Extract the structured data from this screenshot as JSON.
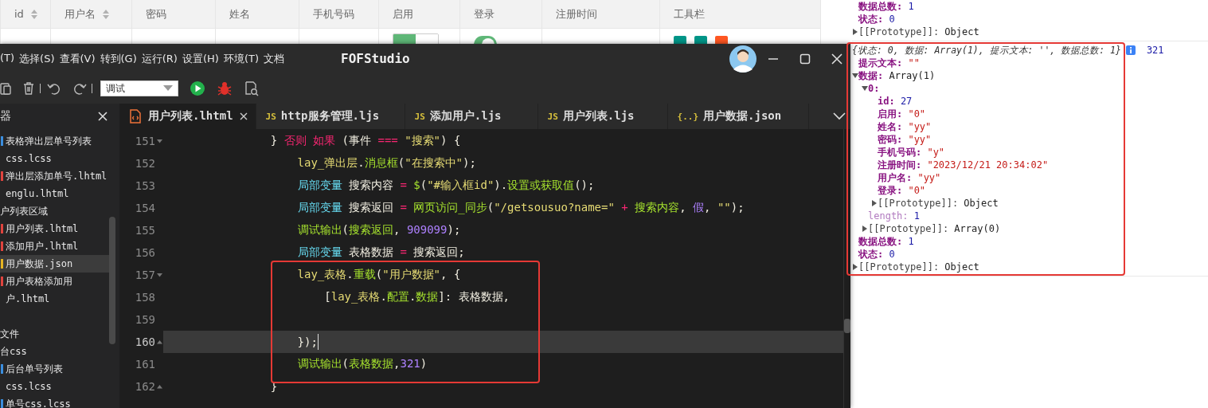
{
  "page_table": {
    "columns": [
      {
        "label": "id",
        "sortable": true
      },
      {
        "label": "用户名",
        "sortable": true
      },
      {
        "label": "密码",
        "sortable": false
      },
      {
        "label": "姓名",
        "sortable": false
      },
      {
        "label": "手机号码",
        "sortable": false
      },
      {
        "label": "启用",
        "sortable": false
      },
      {
        "label": "登录",
        "sortable": false
      },
      {
        "label": "注册时间",
        "sortable": false
      },
      {
        "label": "工具栏",
        "sortable": false
      }
    ],
    "rows": [
      {
        "cells": [
          {
            "kind": "empty"
          },
          {
            "kind": "empty"
          },
          {
            "kind": "empty"
          },
          {
            "kind": "empty"
          },
          {
            "kind": "empty"
          },
          {
            "kind": "switch_button",
            "on": true
          },
          {
            "kind": "toggle",
            "on": true
          },
          {
            "kind": "empty"
          },
          {
            "kind": "actions",
            "buttons": [
              {
                "color": "#009688"
              },
              {
                "color": "#009688"
              },
              {
                "color": "#ff5722"
              }
            ]
          }
        ]
      }
    ]
  },
  "ide": {
    "menu": [
      "(T)",
      "选择(S)",
      "查看(V)",
      "转到(G)",
      "运行(R)",
      "设置(H)",
      "环境(T)",
      "文档"
    ],
    "title": "FOFStudio",
    "mode": "调试",
    "panel_title": "器",
    "tabs": [
      {
        "label": "用户列表.lhtml",
        "kind": "html",
        "selected": true
      },
      {
        "label": "http服务管理.ljs",
        "kind": "js",
        "badge": "JS",
        "selected": false
      },
      {
        "label": "添加用户.ljs",
        "kind": "js",
        "badge": "JS",
        "selected": false
      },
      {
        "label": "用户列表.ljs",
        "kind": "js",
        "badge": "JS",
        "selected": false
      },
      {
        "label": "用户数据.json",
        "kind": "json",
        "badge": "{..}",
        "selected": false
      }
    ],
    "tree": [
      {
        "label": "表格弹出层单号列表",
        "kind": "file",
        "color": "#3b8ede",
        "selected": false
      },
      {
        "label": "css.lcss",
        "kind": "file",
        "selected": false
      },
      {
        "label": "弹出层添加单号.lhtml",
        "kind": "file",
        "color": "#e0443e",
        "selected": false
      },
      {
        "label": "englu.lhtml",
        "kind": "file",
        "selected": false
      },
      {
        "label": "户列表区域",
        "kind": "folder",
        "selected": false,
        "children": [
          {
            "label": "用户列表.lhtml",
            "kind": "file",
            "color": "#e0443e",
            "selected": false
          },
          {
            "label": "添加用户.lhtml",
            "kind": "file",
            "color": "#e0443e",
            "selected": false
          },
          {
            "label": "用户数据.json",
            "kind": "file",
            "color": "#e6b422",
            "selected": true
          },
          {
            "label": "用户表格添加用户.lhtml",
            "kind": "file",
            "color": "#e0443e",
            "selected": false
          }
        ]
      },
      {
        "label": "文件",
        "kind": "folder",
        "selected": false
      },
      {
        "label": "台css",
        "kind": "folder",
        "selected": false,
        "children": [
          {
            "label": "后台单号列表",
            "kind": "file",
            "color": "#3b8ede",
            "selected": false
          },
          {
            "label": "css.lcss",
            "kind": "file",
            "selected": false
          },
          {
            "label": "单号css.lcss",
            "kind": "file",
            "color": "#3b8ede",
            "selected": false
          }
        ]
      }
    ],
    "lines": [
      {
        "number": "151",
        "fold_start": true,
        "tokens": [
          {
            "kind": "plain",
            "text": "                } "
          },
          {
            "kind": "keyword",
            "text": "否则 如果"
          },
          {
            "kind": "plain",
            "text": " (事件 "
          },
          {
            "kind": "keyword",
            "text": "==="
          },
          {
            "kind": "string",
            "text": " \"搜索\""
          },
          {
            "kind": "plain",
            "text": ") {"
          }
        ]
      },
      {
        "number": "152",
        "tokens": [
          {
            "kind": "object",
            "text": "                    lay_弹出层"
          },
          {
            "kind": "plain",
            "text": "."
          },
          {
            "kind": "func",
            "text": "消息框"
          },
          {
            "kind": "plain",
            "text": "("
          },
          {
            "kind": "string",
            "text": "\"在搜索中\""
          },
          {
            "kind": "plain",
            "text": ");"
          }
        ]
      },
      {
        "number": "153",
        "tokens": [
          {
            "kind": "decl",
            "text": "                    局部变量"
          },
          {
            "kind": "plain",
            "text": " 搜索内容 "
          },
          {
            "kind": "keyword",
            "text": "="
          },
          {
            "kind": "func",
            "text": " $"
          },
          {
            "kind": "plain",
            "text": "("
          },
          {
            "kind": "string",
            "text": "\"#输入框id\""
          },
          {
            "kind": "plain",
            "text": ")."
          },
          {
            "kind": "func",
            "text": "设置或获取值"
          },
          {
            "kind": "plain",
            "text": "();"
          }
        ]
      },
      {
        "number": "154",
        "tokens": [
          {
            "kind": "decl",
            "text": "                    局部变量"
          },
          {
            "kind": "plain",
            "text": " 搜索返回 "
          },
          {
            "kind": "keyword",
            "text": "="
          },
          {
            "kind": "func",
            "text": " 网页访问_同步"
          },
          {
            "kind": "plain",
            "text": "("
          },
          {
            "kind": "string",
            "text": "\"/getsousuo?name=\""
          },
          {
            "kind": "keyword",
            "text": " +"
          },
          {
            "kind": "func",
            "text": " 搜索内容"
          },
          {
            "kind": "plain",
            "text": ", "
          },
          {
            "kind": "number",
            "text": "假"
          },
          {
            "kind": "plain",
            "text": ", "
          },
          {
            "kind": "string",
            "text": "\"\""
          },
          {
            "kind": "plain",
            "text": ");"
          }
        ]
      },
      {
        "number": "155",
        "tokens": [
          {
            "kind": "func",
            "text": "                    调试输出"
          },
          {
            "kind": "plain",
            "text": "("
          },
          {
            "kind": "func",
            "text": "搜索返回"
          },
          {
            "kind": "plain",
            "text": ", "
          },
          {
            "kind": "number",
            "text": "909099"
          },
          {
            "kind": "plain",
            "text": ");"
          }
        ]
      },
      {
        "number": "156",
        "tokens": [
          {
            "kind": "decl",
            "text": "                    局部变量"
          },
          {
            "kind": "plain",
            "text": " 表格数据 "
          },
          {
            "kind": "keyword",
            "text": "="
          },
          {
            "kind": "plain",
            "text": " 搜索返回;"
          }
        ]
      },
      {
        "number": "157",
        "fold_start": true,
        "tokens": [
          {
            "kind": "object",
            "text": "                    lay_表格"
          },
          {
            "kind": "plain",
            "text": "."
          },
          {
            "kind": "func",
            "text": "重载"
          },
          {
            "kind": "plain",
            "text": "("
          },
          {
            "kind": "string",
            "text": "\"用户数据\""
          },
          {
            "kind": "plain",
            "text": ", {"
          }
        ]
      },
      {
        "number": "158",
        "tokens": [
          {
            "kind": "plain",
            "text": "                        ["
          },
          {
            "kind": "object",
            "text": "lay_表格"
          },
          {
            "kind": "plain",
            "text": "."
          },
          {
            "kind": "func",
            "text": "配置"
          },
          {
            "kind": "plain",
            "text": "."
          },
          {
            "kind": "func",
            "text": "数据"
          },
          {
            "kind": "plain",
            "text": "]: 表格数据,"
          }
        ]
      },
      {
        "number": "159"
      },
      {
        "number": "160",
        "fold_end": true,
        "current": true,
        "tokens": [
          {
            "kind": "plain",
            "text": "                    });"
          }
        ]
      },
      {
        "number": "161",
        "tokens": [
          {
            "kind": "func",
            "text": "                    调试输出"
          },
          {
            "kind": "plain",
            "text": "("
          },
          {
            "kind": "func",
            "text": "表格数据"
          },
          {
            "kind": "plain",
            "text": ","
          },
          {
            "kind": "number",
            "text": "321"
          },
          {
            "kind": "plain",
            "text": ")"
          }
        ]
      },
      {
        "number": "162",
        "fold_end": true,
        "tokens": [
          {
            "kind": "plain",
            "text": "                }"
          }
        ]
      }
    ]
  },
  "console": {
    "entries": [
      {
        "properties": [
          {
            "label": "数据总数:",
            "value": "1",
            "kind": "number"
          },
          {
            "label": "状态:",
            "value": "0",
            "kind": "number"
          },
          {
            "label": "[[Prototype]]:",
            "internal": true,
            "value": "Object",
            "kind": "object",
            "expanded": false
          }
        ]
      },
      {
        "summary": "{状态: 0, 数据: Array(1), 提示文本: '', 数据总数: 1}",
        "result": "321",
        "properties": [
          {
            "label": "提示文本:",
            "value": "\"\"",
            "kind": "string"
          },
          {
            "label": "数据:",
            "value": "Array(1)",
            "kind": "object",
            "expanded": true,
            "children": [
              {
                "label": "0:",
                "expanded": true,
                "children": [
                  {
                    "label": "id:",
                    "value": "27",
                    "kind": "number"
                  },
                  {
                    "label": "启用:",
                    "value": "\"0\"",
                    "kind": "string"
                  },
                  {
                    "label": "姓名:",
                    "value": "\"yy\"",
                    "kind": "string"
                  },
                  {
                    "label": "密码:",
                    "value": "\"yy\"",
                    "kind": "string"
                  },
                  {
                    "label": "手机号码:",
                    "value": "\"y\"",
                    "kind": "string"
                  },
                  {
                    "label": "注册时间:",
                    "value": "\"2023/12/21 20:34:02\"",
                    "kind": "string"
                  },
                  {
                    "label": "用户名:",
                    "value": "\"yy\"",
                    "kind": "string"
                  },
                  {
                    "label": "登录:",
                    "value": "\"0\"",
                    "kind": "string"
                  },
                  {
                    "label": "[[Prototype]]:",
                    "internal": true,
                    "value": "Object",
                    "kind": "object",
                    "expanded": false
                  }
                ]
              },
              {
                "label": "length:",
                "dim": true,
                "value": "1",
                "kind": "number"
              },
              {
                "label": "[[Prototype]]:",
                "internal": true,
                "value": "Array(0)",
                "kind": "object",
                "expanded": false
              }
            ]
          },
          {
            "label": "数据总数:",
            "value": "1",
            "kind": "number"
          },
          {
            "label": "状态:",
            "value": "0",
            "kind": "number"
          },
          {
            "label": "[[Prototype]]:",
            "internal": true,
            "value": "Object",
            "kind": "object",
            "expanded": false
          }
        ]
      }
    ]
  }
}
